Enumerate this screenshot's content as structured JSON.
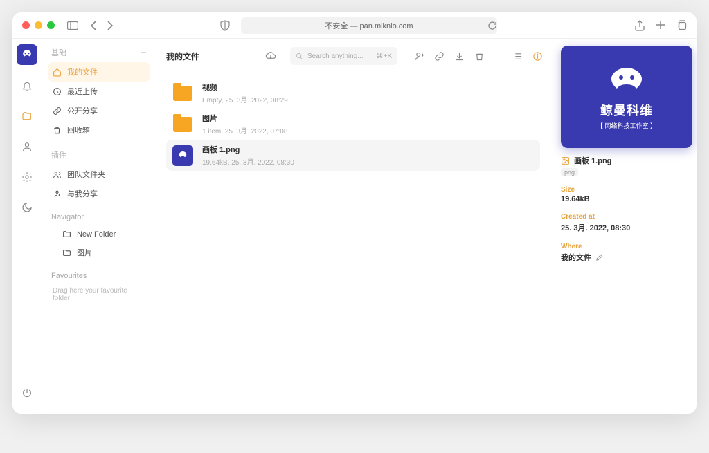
{
  "titlebar": {
    "url_text": "不安全 — pan.miknio.com"
  },
  "sidebar": {
    "sections": [
      {
        "title": "基础",
        "items": [
          {
            "icon": "home",
            "label": "我的文件",
            "active": true
          },
          {
            "icon": "clock",
            "label": "最近上传"
          },
          {
            "icon": "link",
            "label": "公开分享"
          },
          {
            "icon": "trash",
            "label": "回收箱"
          }
        ]
      },
      {
        "title": "插件",
        "items": [
          {
            "icon": "users",
            "label": "团队文件夹"
          },
          {
            "icon": "share",
            "label": "与我分享"
          }
        ]
      }
    ],
    "navigator_title": "Navigator",
    "navigator_items": [
      {
        "label": "New Folder"
      },
      {
        "label": "图片"
      }
    ],
    "favorites_title": "Favourites",
    "favorites_text": "Drag here your favourite folder"
  },
  "main": {
    "breadcrumb": "我的文件",
    "search_placeholder": "Search anything...",
    "search_hotkey": "⌘+K",
    "files": [
      {
        "name": "视频",
        "sub": "Empty, 25. 3月. 2022, 08:29",
        "kind": "folder"
      },
      {
        "name": "图片",
        "sub": "1 item, 25. 3月. 2022, 07:08",
        "kind": "folder"
      },
      {
        "name": "画板 1.png",
        "sub": "19.64kB, 25. 3月. 2022, 08:30",
        "kind": "image",
        "selected": true
      }
    ]
  },
  "detail": {
    "preview_title": "鲸曼科维",
    "preview_sub": "【 网络科技工作室 】",
    "filename": "画板 1.png",
    "ext_badge": "png",
    "size_label": "Size",
    "size_value": "19.64kB",
    "created_label": "Created at",
    "created_value": "25. 3月. 2022, 08:30",
    "where_label": "Where",
    "where_value": "我的文件"
  }
}
